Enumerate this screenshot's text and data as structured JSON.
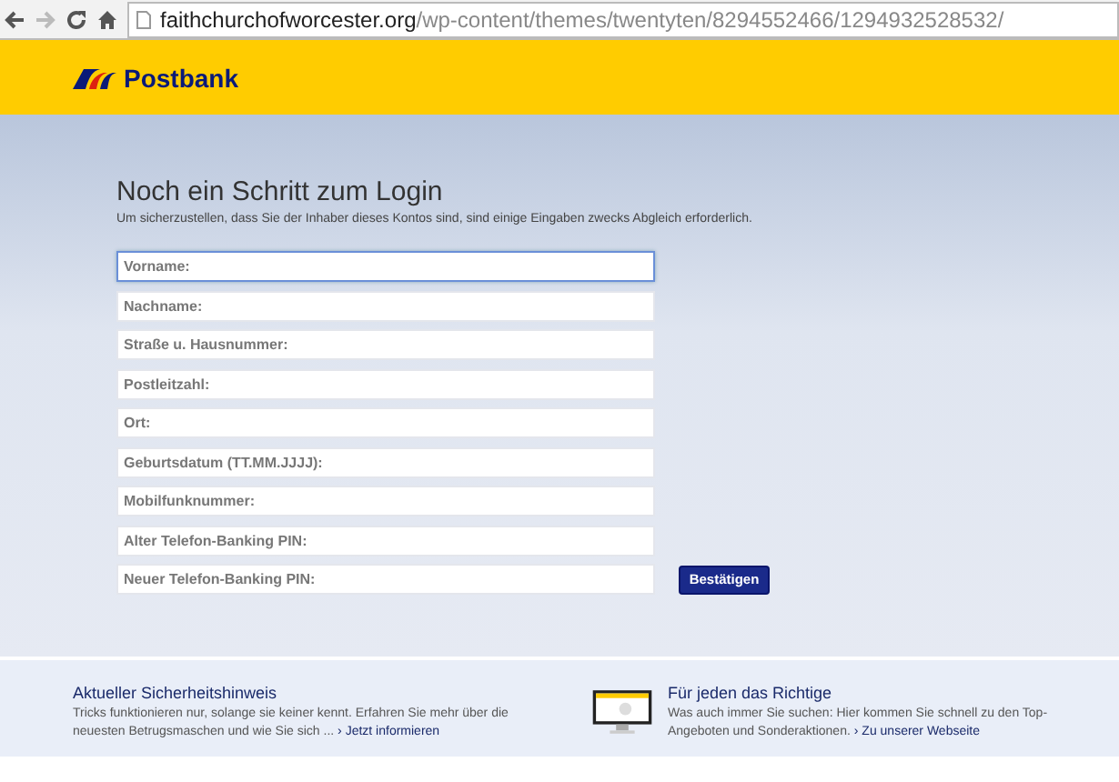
{
  "browser": {
    "url_host": "faithchurchofworcester.org",
    "url_path": "/wp-content/themes/twentyten/8294552466/1294932528532/"
  },
  "header": {
    "logo": "Postbank"
  },
  "form": {
    "title": "Noch ein Schritt zum Login",
    "intro": "Um sicherzustellen, dass Sie der Inhaber dieses Kontos sind, sind einige Eingaben zwecks Abgleich erforderlich.",
    "fields": [
      {
        "placeholder": "Vorname:",
        "focused": true
      },
      {
        "placeholder": "Nachname:",
        "focused": false
      },
      {
        "placeholder": "Straße u. Hausnummer:",
        "focused": false
      },
      {
        "placeholder": "Postleitzahl:",
        "focused": false
      },
      {
        "placeholder": "Ort:",
        "focused": false
      },
      {
        "placeholder": "Geburtsdatum (TT.MM.JJJJ):",
        "focused": false
      },
      {
        "placeholder": "Mobilfunknummer:",
        "focused": false
      },
      {
        "placeholder": "Alter Telefon-Banking PIN:",
        "focused": false
      },
      {
        "placeholder": "Neuer Telefon-Banking PIN:",
        "focused": false
      }
    ],
    "submit": "Bestätigen"
  },
  "footer": [
    {
      "title": "Aktueller Sicherheitshinweis",
      "text": "Tricks funktionieren nur, solange sie keiner kennt. Erfahren Sie mehr über die neuesten Betrugsmaschen und wie Sie sich ...",
      "arrow": "›",
      "link": "Jetzt informieren",
      "has_image": false
    },
    {
      "title": "Für jeden das Richtige",
      "text": "Was auch immer Sie suchen: Hier kommen Sie schnell zu den Top-Angeboten und Sonderaktionen.",
      "arrow": "›",
      "link": "Zu unserer Webseite",
      "has_image": true
    }
  ]
}
